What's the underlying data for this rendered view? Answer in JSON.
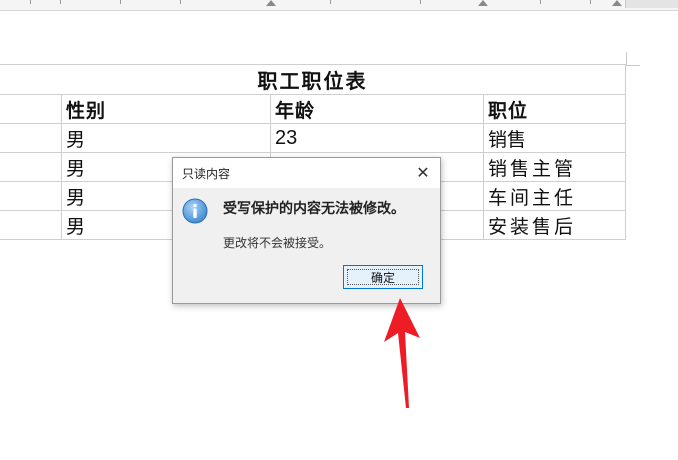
{
  "window": {
    "background": "#ffffff"
  },
  "table": {
    "title": "职工职位表",
    "headers": [
      "性别",
      "年龄",
      "职位"
    ],
    "rows": [
      {
        "gender": "男",
        "age": "23",
        "position": "销售"
      },
      {
        "gender": "男",
        "age": "",
        "position": "销售主管"
      },
      {
        "gender": "男",
        "age": "",
        "position": "车间主任"
      },
      {
        "gender": "男",
        "age": "",
        "position": "安装售后"
      }
    ]
  },
  "dialog": {
    "title": "只读内容",
    "close_icon": "close-icon",
    "icon": "info-icon",
    "message": "受写保护的内容无法被修改。",
    "detail": "更改将不会被接受。",
    "ok_label": "确定",
    "accent": "#0078d7"
  },
  "annotation": {
    "icon": "red-arrow-icon",
    "color": "#ee1c25"
  }
}
